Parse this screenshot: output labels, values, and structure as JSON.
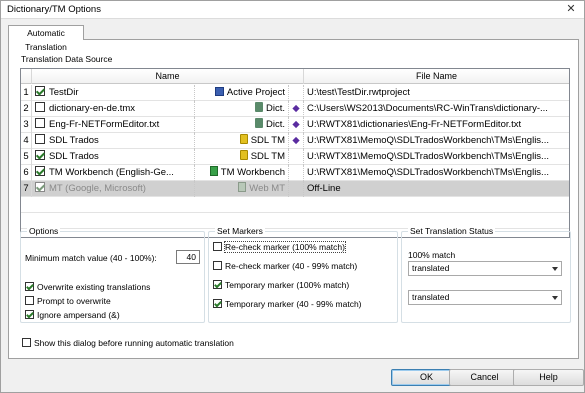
{
  "window": {
    "title": "Dictionary/TM Options",
    "close_glyph": "✕"
  },
  "tab": {
    "label": "Automatic Translation"
  },
  "data_source": {
    "label": "Translation Data Source",
    "columns": {
      "name": "Name",
      "file_name": "File Name"
    },
    "rows": [
      {
        "num": "1",
        "checked": true,
        "name": "TestDir",
        "type": "Active Project",
        "type_icon": "project-icon",
        "file": "U:\\test\\TestDir.rwtproject",
        "arrow": false
      },
      {
        "num": "2",
        "checked": false,
        "name": "dictionary-en-de.tmx",
        "type": "Dict.",
        "type_icon": "dictionary-icon",
        "file": "C:\\Users\\WS2013\\Documents\\RC-WinTrans\\dictionary-...",
        "arrow": true
      },
      {
        "num": "3",
        "checked": false,
        "name": "Eng-Fr-NETFormEditor.txt",
        "type": "Dict.",
        "type_icon": "dictionary-icon",
        "file": "U:\\RWTX81\\dictionaries\\Eng-Fr-NETFormEditor.txt",
        "arrow": true
      },
      {
        "num": "4",
        "checked": false,
        "name": "SDL Trados",
        "type": "SDL TM",
        "type_icon": "tm-icon",
        "file": "U:\\RWTX81\\MemoQ\\SDLTradosWorkbench\\TMs\\Englis...",
        "arrow": true
      },
      {
        "num": "5",
        "checked": true,
        "name": "SDL Trados",
        "type": "SDL TM",
        "type_icon": "tm-icon",
        "file": "U:\\RWTX81\\MemoQ\\SDLTradosWorkbench\\TMs\\Englis...",
        "arrow": false
      },
      {
        "num": "6",
        "checked": true,
        "name": "TM Workbench (English-Ge...",
        "type": "TM Workbench",
        "type_icon": "workbench-icon",
        "file": "U:\\RWTX81\\MemoQ\\SDLTradosWorkbench\\TMs\\Englis...",
        "arrow": false
      },
      {
        "num": "7",
        "checked": true,
        "name": "MT (Google, Microsoft)",
        "type": "Web MT",
        "type_icon": "web-mt-icon",
        "file": "Off-Line",
        "arrow": false,
        "disabled": true
      }
    ]
  },
  "options": {
    "title": "Options",
    "min_match_label": "Minimum match value (40 - 100%):",
    "min_match_value": "40",
    "overwrite_label": "Overwrite existing translations",
    "overwrite_checked": true,
    "prompt_label": "Prompt to overwrite",
    "prompt_checked": false,
    "ignore_amp_label": "Ignore ampersand (&)",
    "ignore_amp_checked": true
  },
  "set_markers": {
    "title": "Set Markers",
    "items": [
      {
        "label": "Re-check marker (100% match)",
        "checked": false
      },
      {
        "label": "Re-check marker (40 - 99% match)",
        "checked": false
      },
      {
        "label": "Temporary marker (100% match)",
        "checked": true
      },
      {
        "label": "Temporary marker (40 - 99% match)",
        "checked": true
      }
    ]
  },
  "translation_status": {
    "title": "Set Translation Status",
    "match100_label": "100% match",
    "match100_value": "translated",
    "match_other_value": "translated"
  },
  "show_dialog": {
    "label": "Show this dialog before running automatic translation",
    "checked": false
  },
  "buttons": {
    "ok": "OK",
    "cancel": "Cancel",
    "help": "Help"
  }
}
